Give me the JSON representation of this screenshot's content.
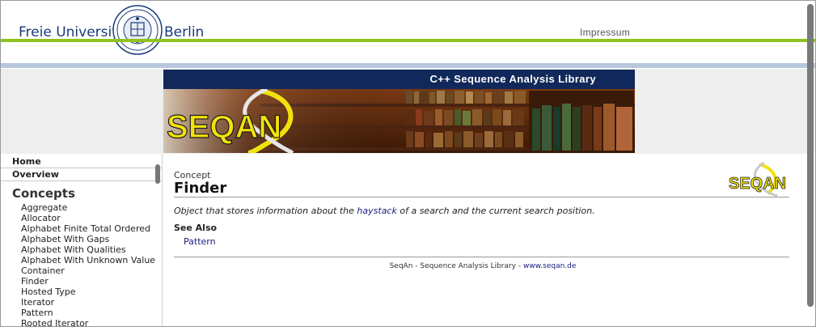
{
  "header": {
    "uni_left": "Freie Universität",
    "uni_right": "Berlin",
    "impressum": "Impressum",
    "seal_icon": "university-seal-icon"
  },
  "banner": {
    "title": "C++ Sequence Analysis Library",
    "logo_text": "SEQAN"
  },
  "sidebar": {
    "nav": [
      {
        "label": "Home"
      },
      {
        "label": "Overview"
      }
    ],
    "concepts_heading": "Concepts",
    "concepts": [
      "Aggregate",
      "Allocator",
      "Alphabet Finite Total Ordered",
      "Alphabet With Gaps",
      "Alphabet With Qualities",
      "Alphabet With Unknown Value",
      "Container",
      "Finder",
      "Hosted Type",
      "Iterator",
      "Pattern",
      "Rooted Iterator"
    ]
  },
  "main": {
    "kicker": "Concept",
    "title": "Finder",
    "desc_before": "Object that stores information about the ",
    "desc_link": "haystack",
    "desc_after": " of a search and the current search position.",
    "see_also": "See Also",
    "see_also_link": "Pattern",
    "footer_text": "SeqAn - Sequence Analysis Library - ",
    "footer_link": "www.seqan.de",
    "small_logo_text": "SEQAN"
  },
  "colors": {
    "green_line": "#8fc31f",
    "blue_line": "#b8c8dc",
    "banner_bar": "#11295a",
    "link": "#1a1a80",
    "logo_yellow": "#f2e20c"
  }
}
